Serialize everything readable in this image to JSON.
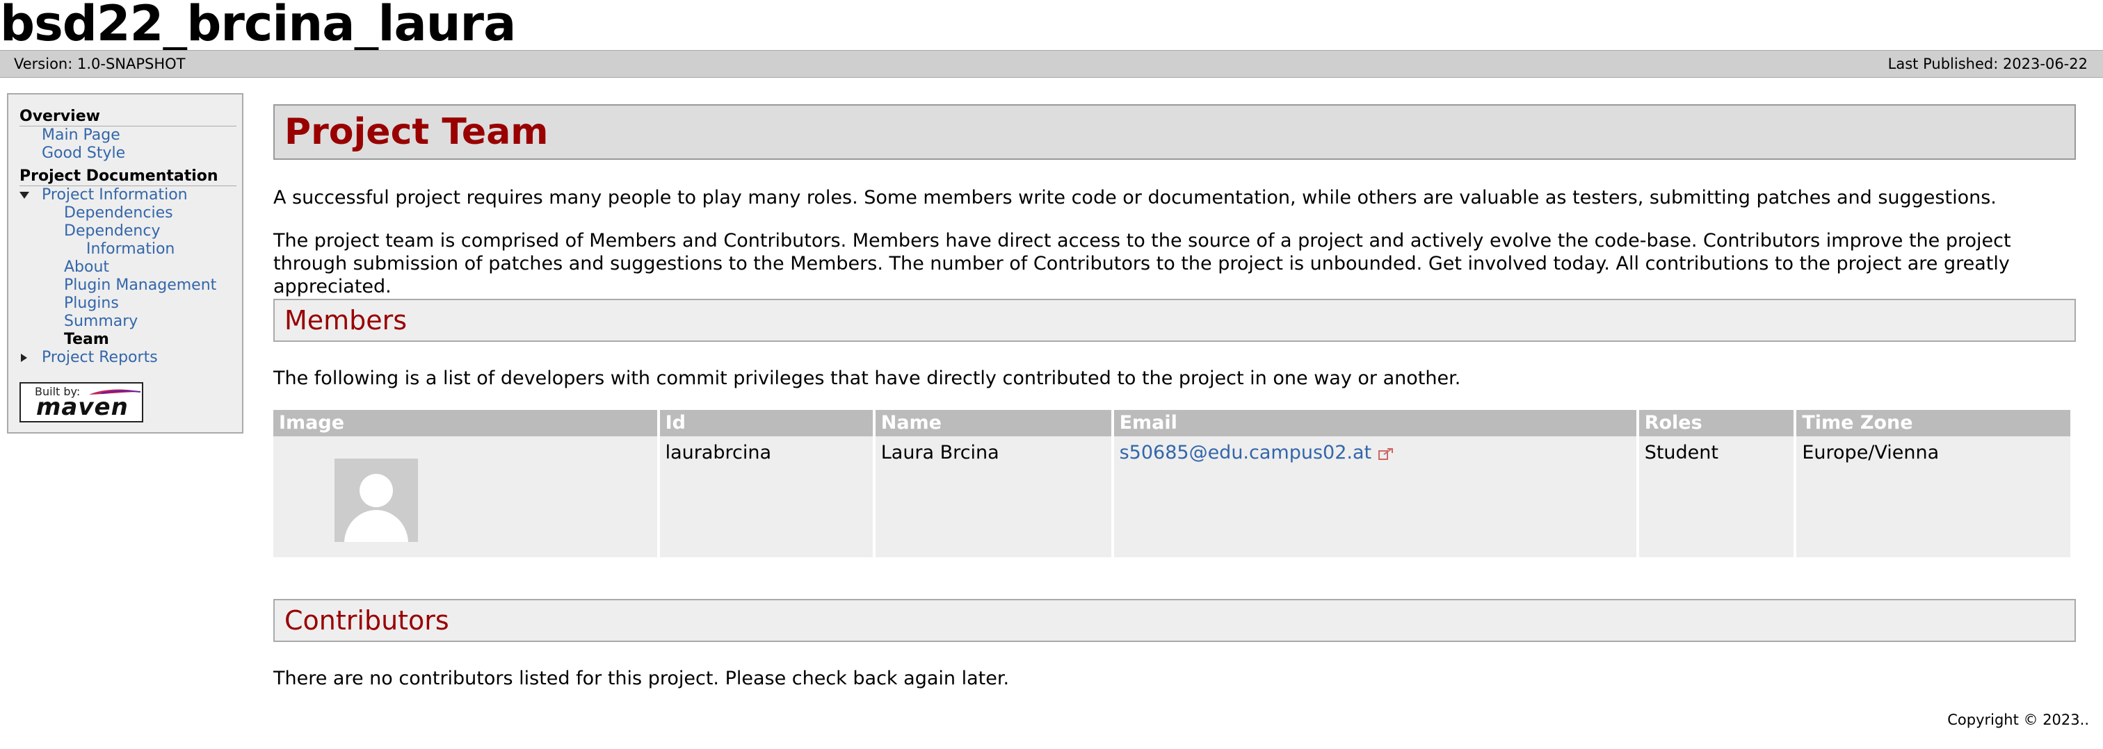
{
  "banner": {
    "title": "bsd22_brcina_laura"
  },
  "breadcrumbs": {
    "version": "Version: 1.0-SNAPSHOT",
    "published": "Last Published: 2023-06-22"
  },
  "nav": {
    "overview_heading": "Overview",
    "main_page": "Main Page",
    "good_style": "Good Style",
    "docs_heading": "Project Documentation",
    "project_information": "Project Information",
    "dependencies": "Dependencies",
    "dependency_information_1": "Dependency",
    "dependency_information_2": "Information",
    "about": "About",
    "plugin_management": "Plugin Management",
    "plugins": "Plugins",
    "summary": "Summary",
    "team": "Team",
    "project_reports": "Project Reports",
    "built_by": "Built by:",
    "maven": "maven"
  },
  "content": {
    "title": "Project Team",
    "intro": "A successful project requires many people to play many roles. Some members write code or documentation, while others are valuable as testers, submitting patches and suggestions.",
    "description": "The project team is comprised of Members and Contributors. Members have direct access to the source of a project and actively evolve the code-base. Contributors improve the project through submission of patches and suggestions to the Members. The number of Contributors to the project is unbounded. Get involved today. All contributions to the project are greatly appreciated.",
    "members_heading": "Members",
    "members_intro": "The following is a list of developers with commit privileges that have directly contributed to the project in one way or another.",
    "table": {
      "headers": [
        "Image",
        "Id",
        "Name",
        "Email",
        "Roles",
        "Time Zone"
      ],
      "rows": [
        {
          "id": "laurabrcina",
          "name": "Laura Brcina",
          "email": "s50685@edu.campus02.at",
          "roles": "Student",
          "timezone": "Europe/Vienna"
        }
      ]
    },
    "contributors_heading": "Contributors",
    "contributors_text": "There are no contributors listed for this project. Please check back again later."
  },
  "footer": {
    "copyright": "Copyright © 2023.."
  },
  "colors": {
    "heading_red": "#990000",
    "link_blue": "#3366aa",
    "header_gray": "#bbbbbb"
  }
}
